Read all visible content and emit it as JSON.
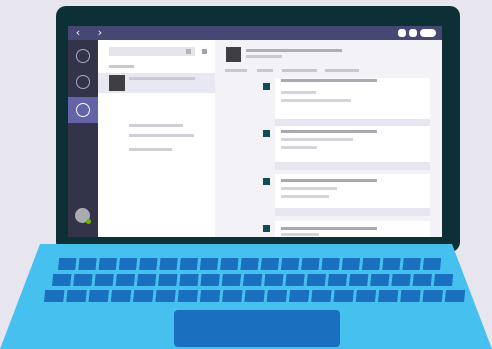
{
  "window": {
    "nav_back_glyph": "‹",
    "nav_forward_glyph": "›"
  },
  "rail": {
    "items": [
      {
        "icon": "circle-icon",
        "active": false
      },
      {
        "icon": "circle-icon",
        "active": false
      },
      {
        "icon": "circle-icon",
        "active": true
      }
    ],
    "user_presence": "available"
  },
  "colors": {
    "titlebar": "#464775",
    "rail": "#33344a",
    "rail_active": "#6264a7",
    "laptop_frame": "#0d3037",
    "keyboard_body": "#46c1ef",
    "keys": "#1a6fbf",
    "message_marker": "#0f4b58"
  }
}
